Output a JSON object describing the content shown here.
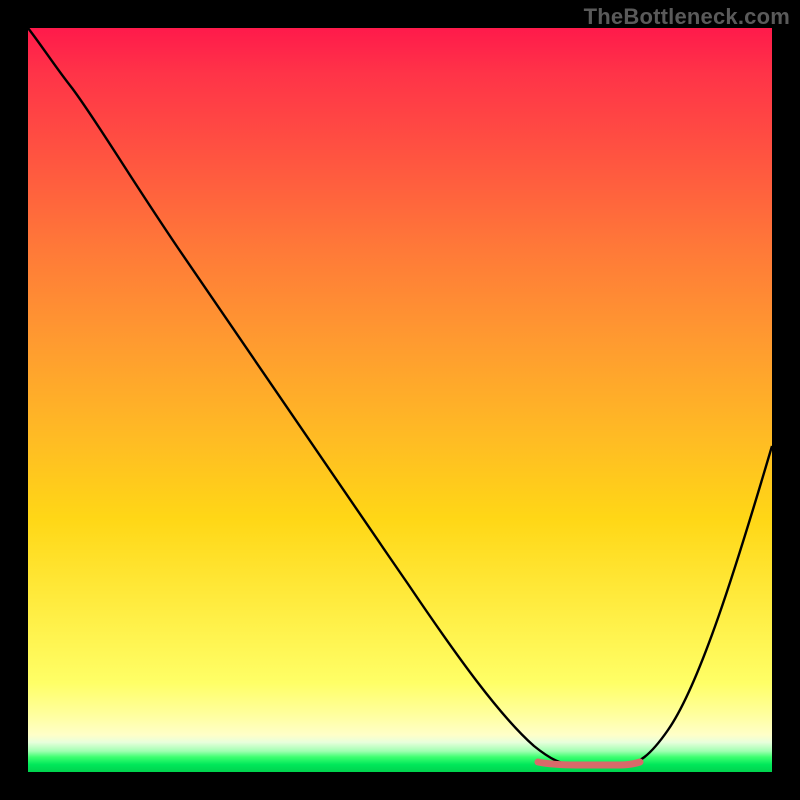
{
  "watermark": "TheBottleneck.com",
  "chart_data": {
    "type": "line",
    "title": "",
    "xlabel": "",
    "ylabel": "",
    "xlim": [
      0,
      100
    ],
    "ylim": [
      0,
      100
    ],
    "series": [
      {
        "name": "curve",
        "x": [
          0,
          5,
          10,
          20,
          30,
          40,
          50,
          60,
          66,
          70,
          74,
          78,
          82,
          90,
          100
        ],
        "values": [
          100,
          96,
          92,
          80,
          67,
          54,
          41,
          27,
          15,
          7,
          2,
          1,
          2,
          18,
          45
        ]
      }
    ],
    "flat_segment": {
      "x_start": 70,
      "x_end": 82,
      "y": 1.5,
      "color": "#d86a6a"
    },
    "gradient_stops": [
      {
        "pos": 0,
        "color": "#ff1a4b"
      },
      {
        "pos": 18,
        "color": "#ff5640"
      },
      {
        "pos": 42,
        "color": "#ff9a30"
      },
      {
        "pos": 66,
        "color": "#ffd716"
      },
      {
        "pos": 88,
        "color": "#ffff66"
      },
      {
        "pos": 96,
        "color": "#e8ffdc"
      },
      {
        "pos": 99,
        "color": "#00e85a"
      },
      {
        "pos": 100,
        "color": "#00d24e"
      }
    ]
  }
}
